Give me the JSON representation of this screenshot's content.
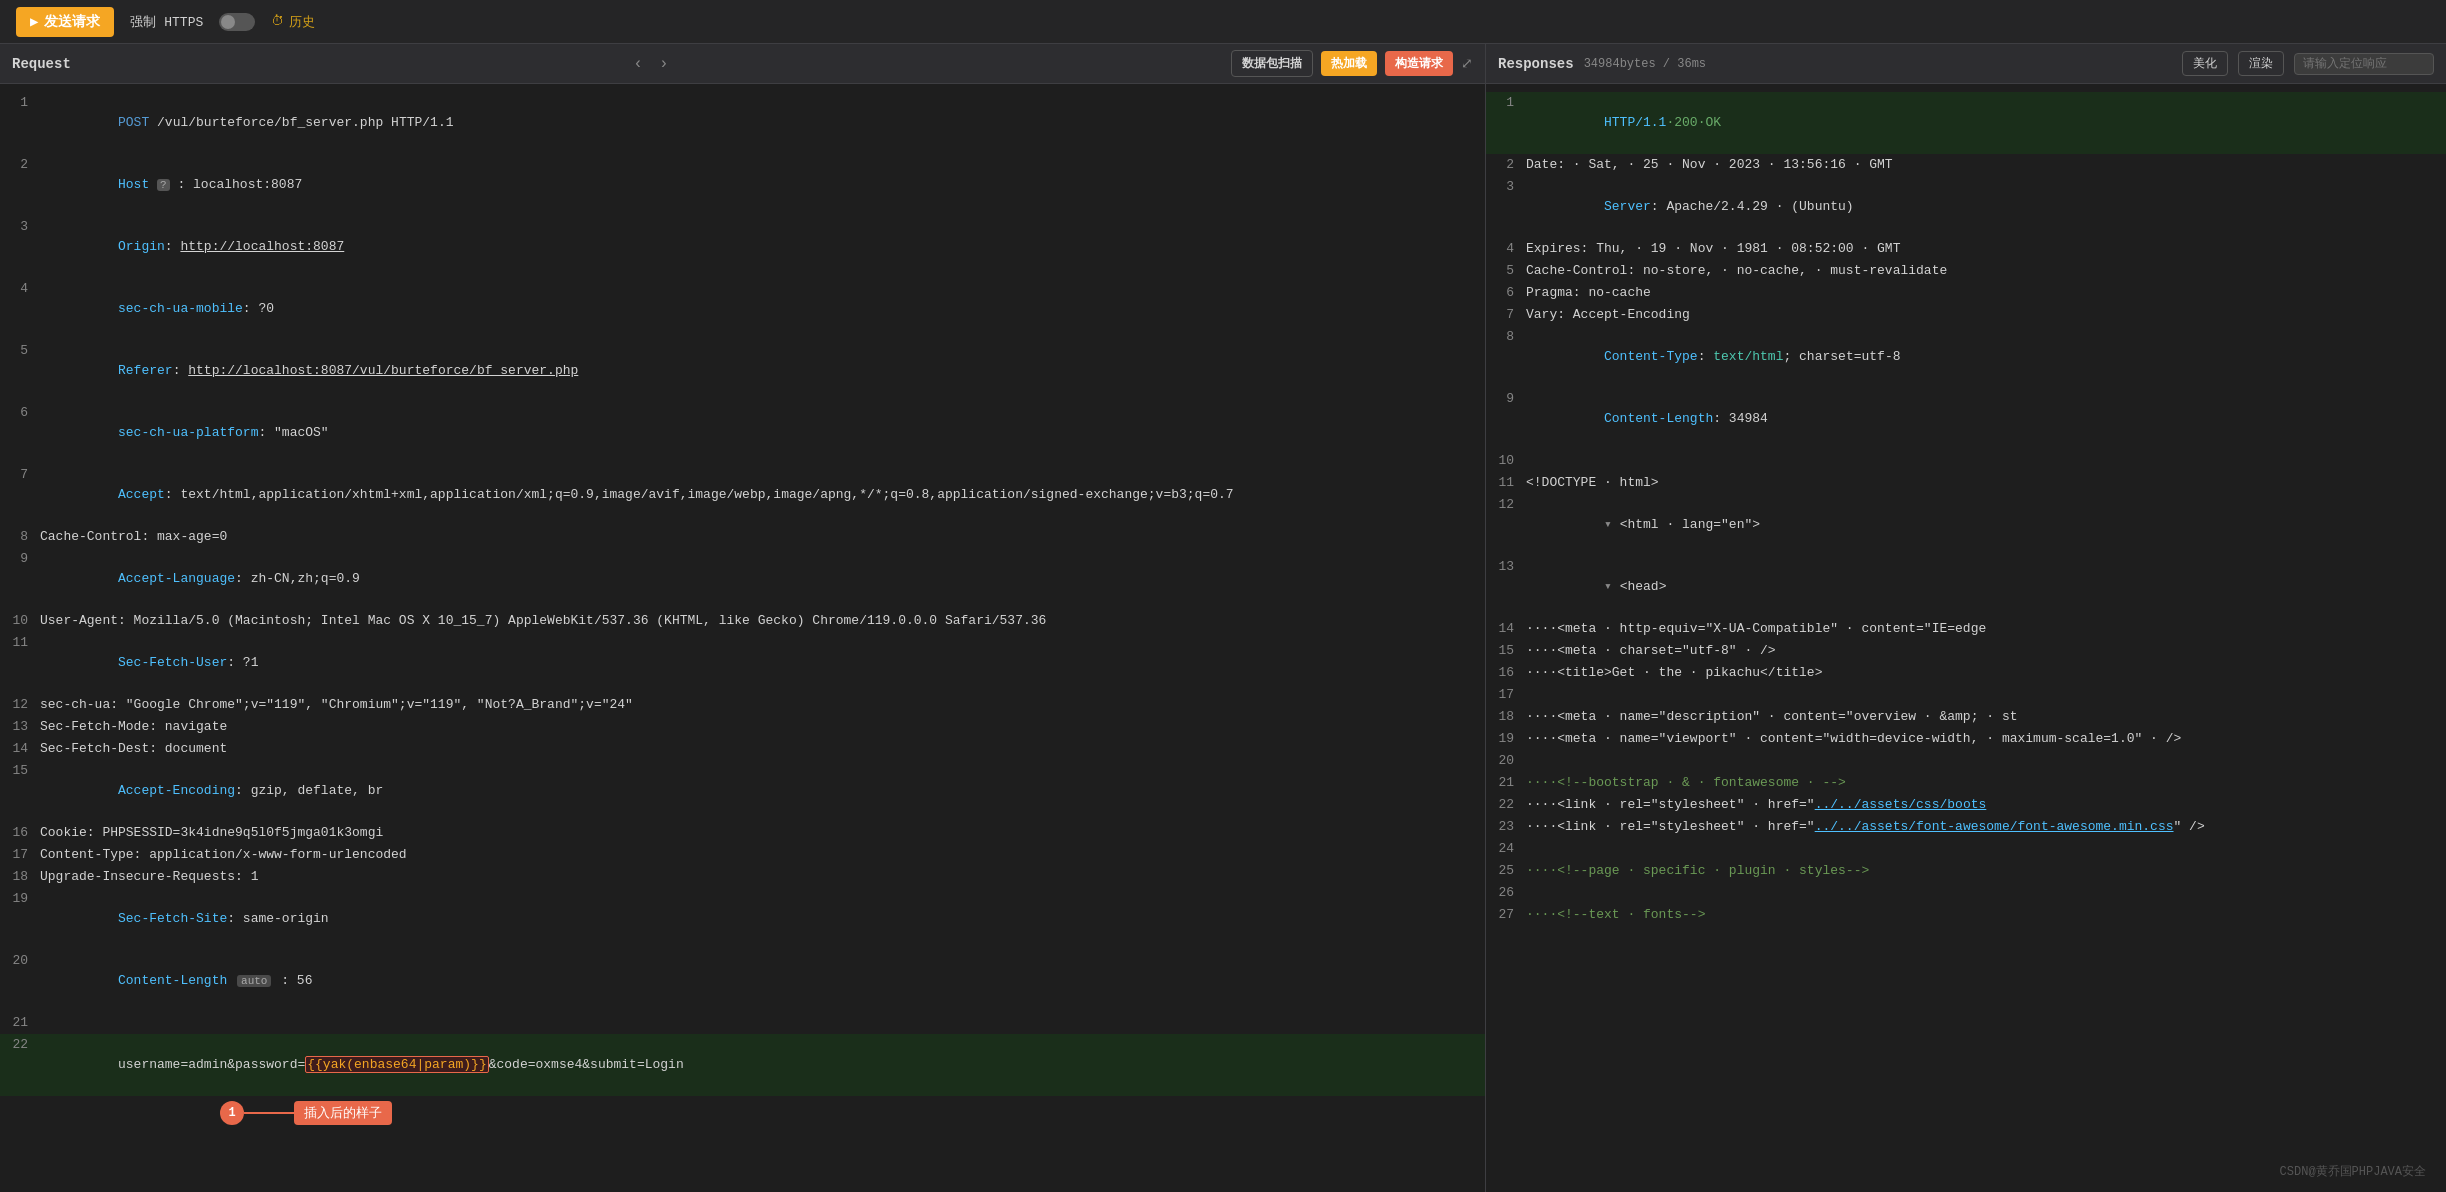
{
  "toolbar": {
    "send_label": "发送请求",
    "https_label": "强制 HTTPS",
    "history_label": "历史"
  },
  "request_panel": {
    "title": "Request",
    "btn_scan": "数据包扫描",
    "btn_hotload": "热加载",
    "btn_construct": "构造请求",
    "lines": [
      {
        "num": 1,
        "content": "POST·/vul/burteforce/bf_server.php·HTTP/1.1",
        "type": "method"
      },
      {
        "num": 2,
        "content": "Host·?·:·localhost:8087",
        "type": "host"
      },
      {
        "num": 3,
        "content": "Origin:·http://localhost:8087",
        "type": "header"
      },
      {
        "num": 4,
        "content": "sec-ch-ua-mobile:·?0",
        "type": "header"
      },
      {
        "num": 5,
        "content": "Referer:·http://localhost:8087/vul/burteforce/bf_server.php",
        "type": "header"
      },
      {
        "num": 6,
        "content": "sec-ch-ua-platform:·\"macOS\"",
        "type": "header"
      },
      {
        "num": 7,
        "content": "Accept:·text/html,application/xhtml+xml,application/xml;q=0.9,image/avif,image/webp,image/apng,*/*;q=0.8,application/signed-exchange;v=b3;q=0.7",
        "type": "header"
      },
      {
        "num": 8,
        "content": "Cache-Control:·max-age=0",
        "type": "plain"
      },
      {
        "num": 9,
        "content": "Accept-Language:·zh-CN,zh;q=0.9",
        "type": "header"
      },
      {
        "num": 10,
        "content": "User-Agent:·Mozilla/5.0·(Macintosh;·Intel·Mac·OS·X·10_15_7)·AppleWebKit/537.36·(KHTML,·like·Gecko)·Chrome/119.0.0.0·Safari/537.36",
        "type": "plain"
      },
      {
        "num": 11,
        "content": "Sec-Fetch-User:·?1",
        "type": "header"
      },
      {
        "num": 12,
        "content": "sec-ch-ua:·\"Google·Chrome\";v=\"119\",·\"Chromium\";v=\"119\",·\"Not?A_Brand\";v=\"24\"",
        "type": "plain"
      },
      {
        "num": 13,
        "content": "Sec-Fetch-Mode:·navigate",
        "type": "plain"
      },
      {
        "num": 14,
        "content": "Sec-Fetch-Dest:·document",
        "type": "plain"
      },
      {
        "num": 15,
        "content": "Accept-Encoding:·gzip,·deflate,·br",
        "type": "header"
      },
      {
        "num": 16,
        "content": "Cookie:·PHPSESSID=3k4idne9q5l0f5jmga01k3omgi",
        "type": "plain"
      },
      {
        "num": 17,
        "content": "Content-Type:·application/x-www-form-urlencoded",
        "type": "plain"
      },
      {
        "num": 18,
        "content": "Upgrade-Insecure-Requests:·1",
        "type": "plain"
      },
      {
        "num": 19,
        "content": "Sec-Fetch-Site:·same-origin",
        "type": "header"
      },
      {
        "num": 20,
        "content": "Content-Length·auto·:·56",
        "type": "header"
      },
      {
        "num": 21,
        "content": "",
        "type": "empty"
      },
      {
        "num": 22,
        "content": "username=admin&password={{yak(enbase64|param)}}&code=oxmse4&submit=Login",
        "type": "body"
      }
    ]
  },
  "response_panel": {
    "title": "Responses",
    "meta": "34984bytes / 36ms",
    "btn_beautify": "美化",
    "btn_render": "渲染",
    "search_placeholder": "请输入定位响应",
    "lines": [
      {
        "num": 1,
        "content": "HTTP/1.1·200·OK",
        "type": "status"
      },
      {
        "num": 2,
        "content": "Date:··Sat,·25·Nov·2023·13:56:16·GMT",
        "type": "plain"
      },
      {
        "num": 3,
        "content": "Server:·Apache/2.4.29·(Ubuntu)",
        "type": "header"
      },
      {
        "num": 4,
        "content": "Expires:·Thu,·19·Nov·1981·08:52:00·GMT",
        "type": "plain"
      },
      {
        "num": 5,
        "content": "Cache-Control:·no-store,·no-cache,·must-revalidate",
        "type": "plain"
      },
      {
        "num": 6,
        "content": "Pragma:·no-cache",
        "type": "plain"
      },
      {
        "num": 7,
        "content": "Vary:·Accept-Encoding",
        "type": "plain"
      },
      {
        "num": 8,
        "content": "Content-Type:·text/html;·charset=utf-8",
        "type": "header"
      },
      {
        "num": 9,
        "content": "Content-Length:·34984",
        "type": "header"
      },
      {
        "num": 10,
        "content": "",
        "type": "empty"
      },
      {
        "num": 11,
        "content": "<!DOCTYPE·html>",
        "type": "tag"
      },
      {
        "num": 12,
        "content": "<html·lang=\"en\">",
        "type": "tag"
      },
      {
        "num": 13,
        "content": "<head>",
        "type": "tag"
      },
      {
        "num": 14,
        "content": "····<meta·http-equiv=\"X-UA-Compatible\"·content=\"IE=edge",
        "type": "tag"
      },
      {
        "num": 15,
        "content": "····<meta·charset=\"utf-8\"·/>",
        "type": "tag"
      },
      {
        "num": 16,
        "content": "····<title>Get·the·pikachu</title>",
        "type": "tag"
      },
      {
        "num": 17,
        "content": "",
        "type": "empty"
      },
      {
        "num": 18,
        "content": "····<meta·name=\"description\"·content=\"overview·&amp;·st",
        "type": "tag"
      },
      {
        "num": 19,
        "content": "····<meta·name=\"viewport\"·content=\"width=device-width,·maximum-scale=1.0\"·/>",
        "type": "tag"
      },
      {
        "num": 20,
        "content": "",
        "type": "empty"
      },
      {
        "num": 21,
        "content": "····<!--bootstrap·&·fontawesome·-->",
        "type": "comment"
      },
      {
        "num": 22,
        "content": "····<link·rel=\"stylesheet\"·href=\"../../assets/css/boots",
        "type": "tag"
      },
      {
        "num": 23,
        "content": "····<link·rel=\"stylesheet\"·href=\"../../assets/font-awesome/font-awesome.min.css\"·/>",
        "type": "tag"
      },
      {
        "num": 24,
        "content": "",
        "type": "empty"
      },
      {
        "num": 25,
        "content": "····<!--page·specific·plugin·styles-->",
        "type": "comment"
      },
      {
        "num": 26,
        "content": "",
        "type": "empty"
      },
      {
        "num": 27,
        "content": "····<!--text·fonts-->",
        "type": "comment"
      }
    ]
  },
  "annotation": {
    "callout_num": "1",
    "callout_text": "插入后的样子"
  },
  "watermark": "CSDN@黄乔国PHPJAVA安全"
}
